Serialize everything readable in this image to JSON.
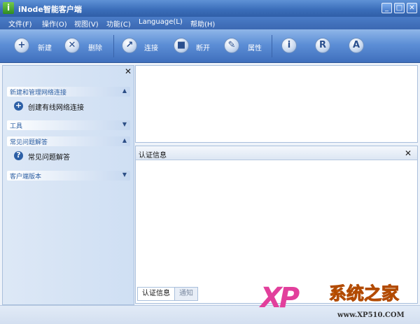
{
  "window": {
    "title": "iNode智能客户端",
    "logo_letter": "i",
    "controls": [
      "_",
      "□",
      "✕"
    ]
  },
  "menu": [
    "文件(F)",
    "操作(O)",
    "视图(V)",
    "功能(C)",
    "Language(L)",
    "帮助(H)"
  ],
  "toolbar": {
    "new_label": "新建",
    "delete_label": "删除",
    "connect_label": "连接",
    "disconnect_label": "断开",
    "properties_label": "属性",
    "info_glyph": "i",
    "r_glyph": "R",
    "a_glyph": "A"
  },
  "left_panel": {
    "close": "✕",
    "sections": [
      {
        "title": "新建和管理网络连接",
        "chevron": "▲",
        "links": [
          "创建有线网络连接"
        ]
      },
      {
        "title": "工具",
        "chevron": "▼"
      },
      {
        "title": "常见问题解答",
        "chevron": "▲",
        "links": [
          "常见问题解答"
        ]
      },
      {
        "title": "客户端版本",
        "chevron": "▼"
      }
    ]
  },
  "auth_pane": {
    "title": "认证信息",
    "close": "✕",
    "tabs": [
      "认证信息",
      "通知"
    ]
  },
  "watermark": {
    "xp": "XP",
    "brand": "系统之家",
    "url": "www.XP510.COM"
  },
  "colors": {
    "titlebar": "#3c6fbb",
    "toolbar": "#5d8fd6",
    "section_title": "#2d5fa3",
    "watermark_pink": "#e23f9c",
    "watermark_orange": "#ff8a00"
  }
}
